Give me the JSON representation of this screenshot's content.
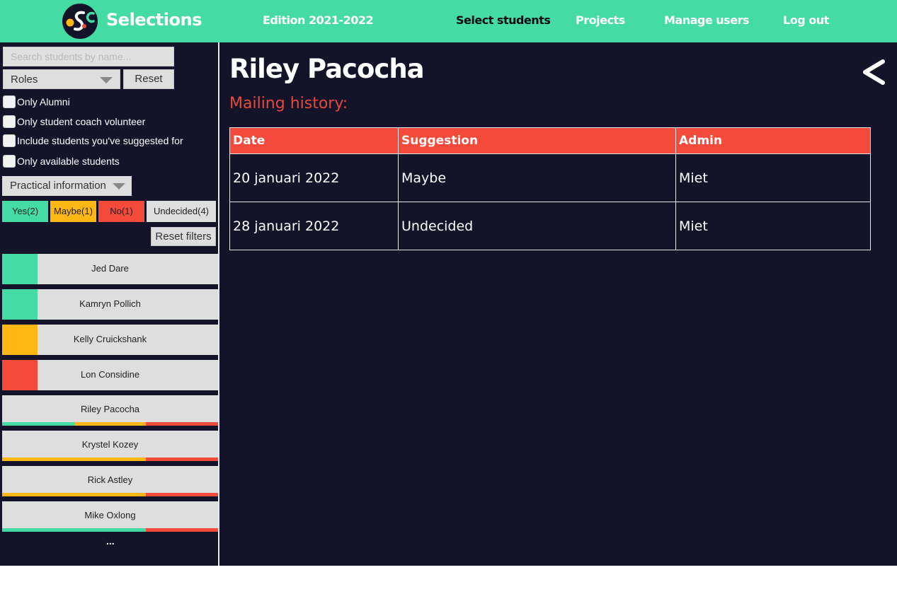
{
  "header": {
    "brand": "Selections",
    "edition": "Edition 2021-2022",
    "nav": [
      "Select students",
      "Projects",
      "Manage users",
      "Log out"
    ]
  },
  "sidebar": {
    "search_placeholder": "Search students by name...",
    "roles_label": "Roles",
    "reset_label": "Reset",
    "checks": [
      "Only Alumni",
      "Only student coach volunteer",
      "Include students you've suggested for",
      "Only available students"
    ],
    "practical_label": "Practical information",
    "filters": [
      "Yes(2)",
      "Maybe(1)",
      "No(1)",
      "Undecided(4)"
    ],
    "reset_filters_label": "Reset filters",
    "students": [
      {
        "name": "Jed Dare",
        "status": "yes"
      },
      {
        "name": "Kamryn Pollich",
        "status": "yes"
      },
      {
        "name": "Kelly Cruickshank",
        "status": "maybe"
      },
      {
        "name": "Lon Considine",
        "status": "no"
      },
      {
        "name": "Riley Pacocha",
        "status": "undecided",
        "bars": [
          "yes",
          "maybe",
          "no"
        ]
      },
      {
        "name": "Krystel Kozey",
        "status": "undecided",
        "bars": [
          "maybe",
          "maybe",
          "no"
        ]
      },
      {
        "name": "Rick Astley",
        "status": "undecided",
        "bars": [
          "maybe",
          "maybe",
          "no"
        ]
      },
      {
        "name": "Mike Oxlong",
        "status": "undecided",
        "bars": [
          "yes",
          "yes",
          "no"
        ]
      }
    ],
    "more": "..."
  },
  "main": {
    "student_name": "Riley Pacocha",
    "mailing_title": "Mailing history:",
    "columns": [
      "Date",
      "Suggestion",
      "Admin"
    ],
    "rows": [
      [
        "20 januari 2022",
        "Maybe",
        "Miet"
      ],
      [
        "28 januari 2022",
        "Undecided",
        "Miet"
      ]
    ]
  },
  "colors": {
    "accent": "#44dba4",
    "background": "#13142a",
    "yes": "#44dba4",
    "maybe": "#fcb714",
    "no": "#f44a3b",
    "undecided": "#dedede"
  }
}
